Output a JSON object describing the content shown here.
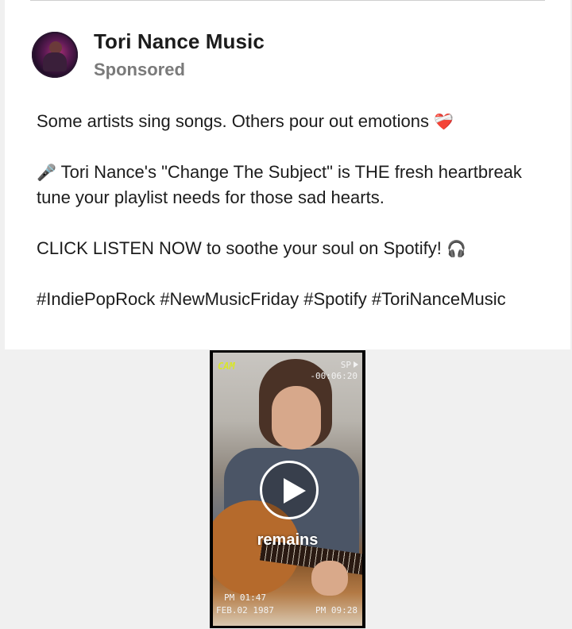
{
  "post": {
    "page_name": "Tori Nance Music",
    "sponsored_label": "Sponsored",
    "avatar_alt": "Tori Nance Music profile picture",
    "lines": {
      "p1_text": "Some artists sing songs. Others pour out emotions",
      "p1_emoji": "❤️‍🩹",
      "p2_emoji": "🎤",
      "p2_text": "Tori Nance's \"Change The Subject\" is THE fresh heartbreak tune your playlist needs for those sad hearts.",
      "p3_text": "CLICK LISTEN NOW to soothe your soul on Spotify!",
      "p3_emoji": "🎧",
      "p4_text": "#IndiePopRock #NewMusicFriday #Spotify #ToriNanceMusic"
    }
  },
  "video": {
    "cam_label": "CAM",
    "sp_label": "SP",
    "counter": "-00:06:20",
    "time_pm": "PM 01:47",
    "date": "FEB.02 1987",
    "time2": "PM 09:28",
    "caption": "remains",
    "play_icon": "play-icon"
  }
}
